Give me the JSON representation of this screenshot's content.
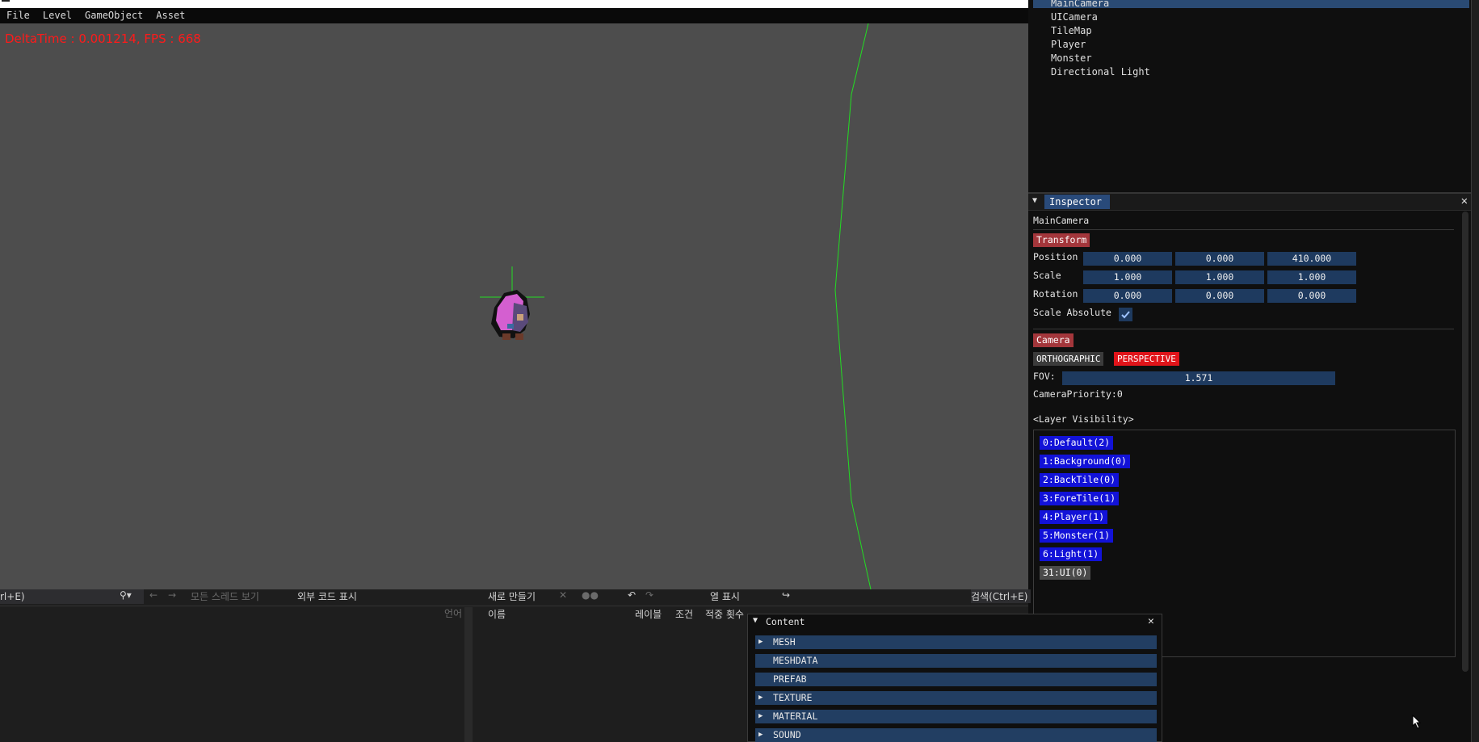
{
  "menubar": {
    "items": [
      "File",
      "Level",
      "GameObject",
      "Asset"
    ]
  },
  "viewport": {
    "fps_text": "DeltaTime : 0.001214, FPS : 668"
  },
  "hierarchy": {
    "items": [
      "MainCamera",
      "UICamera",
      "TileMap",
      "Player",
      "Monster",
      "Directional Light"
    ],
    "selected": "MainCamera"
  },
  "inspector": {
    "tab_label": "Inspector",
    "object_name": "MainCamera",
    "transform_header": "Transform",
    "position_label": "Position",
    "position": [
      "0.000",
      "0.000",
      "410.000"
    ],
    "scale_label": "Scale",
    "scale": [
      "1.000",
      "1.000",
      "1.000"
    ],
    "rotation_label": "Rotation",
    "rotation": [
      "0.000",
      "0.000",
      "0.000"
    ],
    "scale_absolute_label": "Scale Absolute",
    "scale_absolute_checked": true,
    "camera_header": "Camera",
    "ortho_label": "ORTHOGRAPHIC",
    "persp_label": "PERSPECTIVE",
    "fov_label": "FOV:",
    "fov_value": "1.571",
    "camera_priority": "CameraPriority:0",
    "layer_visibility_label": "<Layer Visibility>",
    "layers": [
      {
        "label": "0:Default(2)",
        "on": true
      },
      {
        "label": "1:Background(0)",
        "on": true
      },
      {
        "label": "2:BackTile(0)",
        "on": true
      },
      {
        "label": "3:ForeTile(1)",
        "on": true
      },
      {
        "label": "4:Player(1)",
        "on": true
      },
      {
        "label": "5:Monster(1)",
        "on": true
      },
      {
        "label": "6:Light(1)",
        "on": true
      },
      {
        "label": "31:UI(0)",
        "on": false
      }
    ]
  },
  "vs_left": {
    "search_placeholder": "rl+E)",
    "show_all_threads": "모든 스레드 보기",
    "show_external_code": "외부 코드 표시",
    "lang_col": "언어"
  },
  "vs_mid": {
    "new_label": "새로 만들기",
    "columns_label": "열 표시",
    "search_label": "검색(Ctrl+E)",
    "col_name": "이름",
    "col_label": "레이블",
    "col_condition": "조건",
    "col_hitcount": "적중 횟수"
  },
  "content_panel": {
    "title": "Content",
    "items": [
      {
        "label": "MESH",
        "expandable": true
      },
      {
        "label": "MESHDATA",
        "expandable": false
      },
      {
        "label": "PREFAB",
        "expandable": false
      },
      {
        "label": "TEXTURE",
        "expandable": true
      },
      {
        "label": "MATERIAL",
        "expandable": true
      },
      {
        "label": "SOUND",
        "expandable": true
      }
    ]
  },
  "colors": {
    "viewport_bg": "#4d4d4d",
    "fps_text": "#ff1a1a",
    "header_red": "#a3363b",
    "field_blue": "#1e3a5f",
    "layer_on": "#1212d8",
    "perspective_active": "#e0141a",
    "frustum_line": "#22dd22"
  }
}
